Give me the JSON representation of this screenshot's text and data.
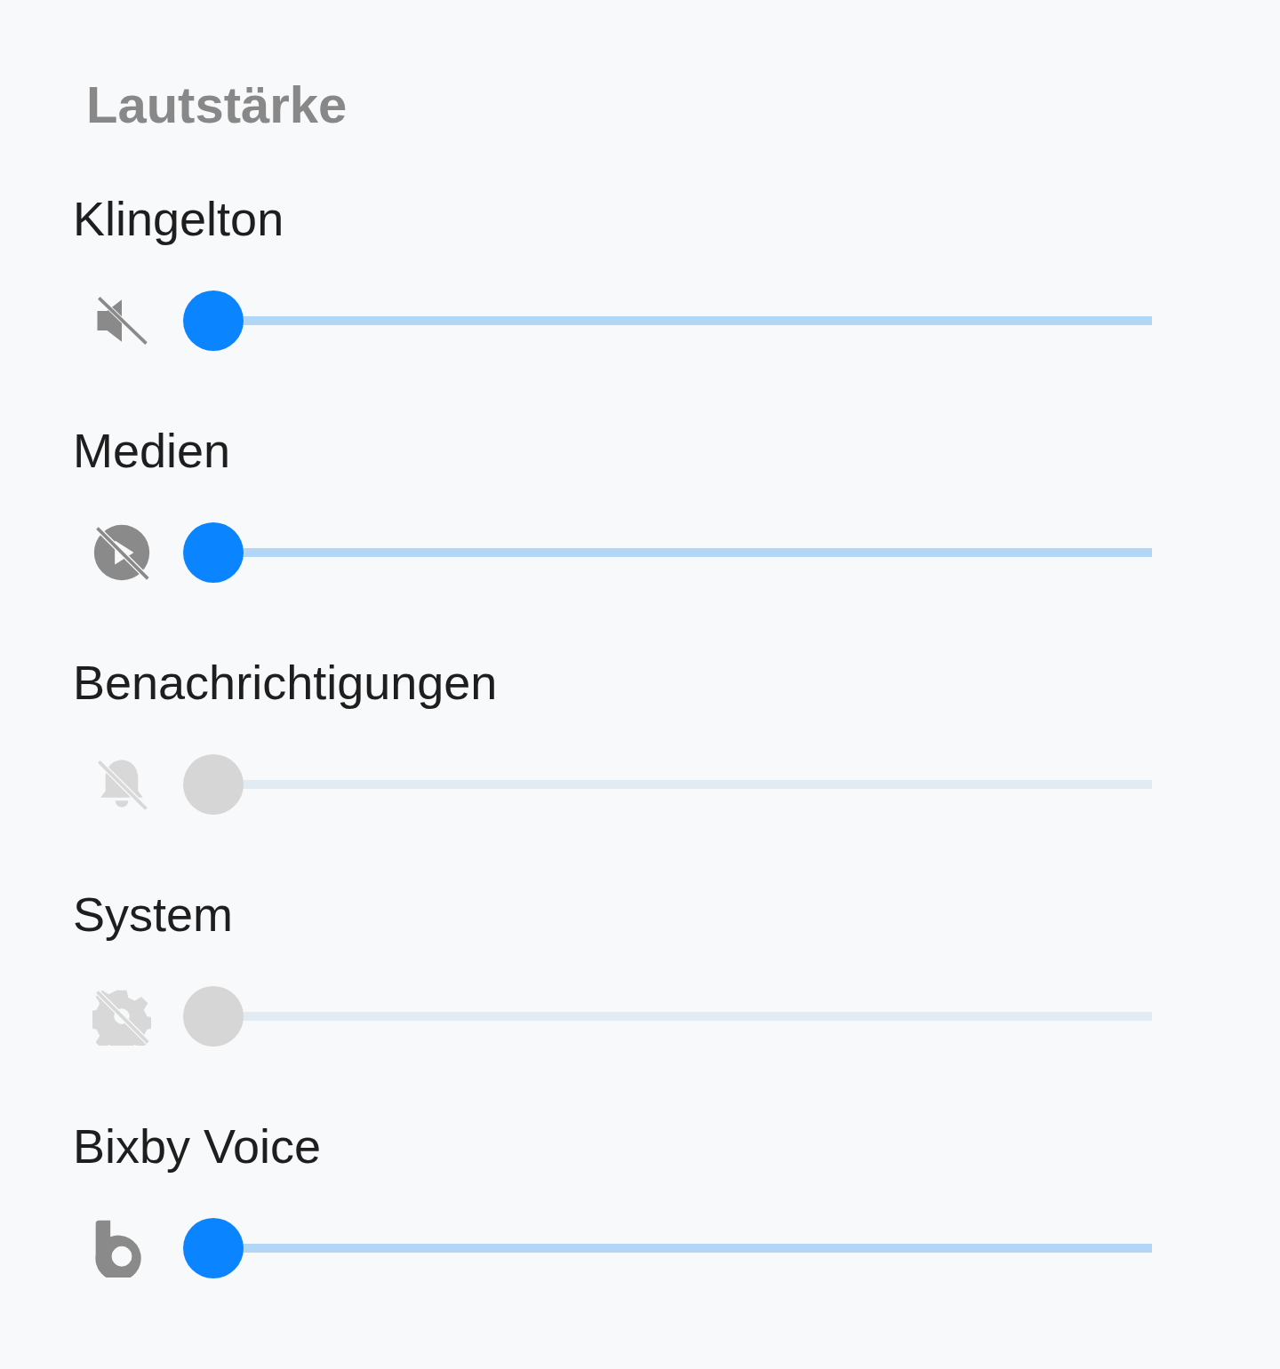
{
  "title": "Lautstärke",
  "channels": [
    {
      "name": "Klingelton",
      "disabled": false,
      "level": 0
    },
    {
      "name": "Medien",
      "disabled": false,
      "level": 0
    },
    {
      "name": "Benachrichtigungen",
      "disabled": true,
      "level": 0
    },
    {
      "name": "System",
      "disabled": true,
      "level": 0
    },
    {
      "name": "Bixby Voice",
      "disabled": false,
      "level": 0
    }
  ]
}
